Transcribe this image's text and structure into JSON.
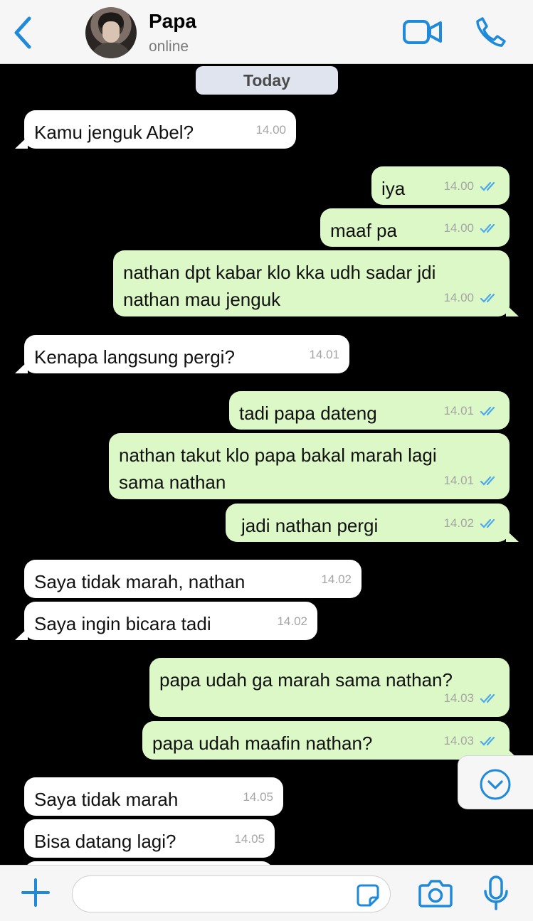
{
  "header": {
    "title": "Papa",
    "status": "online"
  },
  "chat": {
    "date_label": "Today",
    "messages": [
      {
        "text": "Kamu jenguk Abel?",
        "time": "14.00"
      },
      {
        "text": "iya",
        "time": "14.00"
      },
      {
        "text": "maaf pa",
        "time": "14.00"
      },
      {
        "line1": "nathan dpt kabar klo kka udh sadar jdi",
        "line2": "nathan mau jenguk",
        "time": "14.00"
      },
      {
        "text": "Kenapa langsung pergi?",
        "time": "14.01"
      },
      {
        "text": "tadi papa dateng",
        "time": "14.01"
      },
      {
        "line1": "nathan takut klo papa bakal marah lagi",
        "line2": "sama nathan",
        "time": "14.01"
      },
      {
        "text": "jadi nathan pergi",
        "time": "14.02"
      },
      {
        "text": "Saya tidak marah, nathan",
        "time": "14.02"
      },
      {
        "text": "Saya ingin bicara tadi",
        "time": "14.02"
      },
      {
        "text": "papa udah ga marah sama nathan?",
        "time": "14.03"
      },
      {
        "text": "papa udah maafin nathan?",
        "time": "14.03"
      },
      {
        "text": "Saya tidak marah",
        "time": "14.05"
      },
      {
        "text": "Bisa datang lagi?",
        "time": "14.05"
      }
    ]
  },
  "composer": {
    "value": ""
  },
  "colors": {
    "accent": "#1f8ad9",
    "incoming": "#ffffff",
    "outgoing": "#dcf8c6",
    "background": "#000000",
    "read_ticks": "#4ca9ee"
  },
  "icons": [
    "back-icon",
    "video-call-icon",
    "phone-icon",
    "chevron-down-icon",
    "plus-icon",
    "sticker-icon",
    "camera-icon",
    "microphone-icon"
  ]
}
